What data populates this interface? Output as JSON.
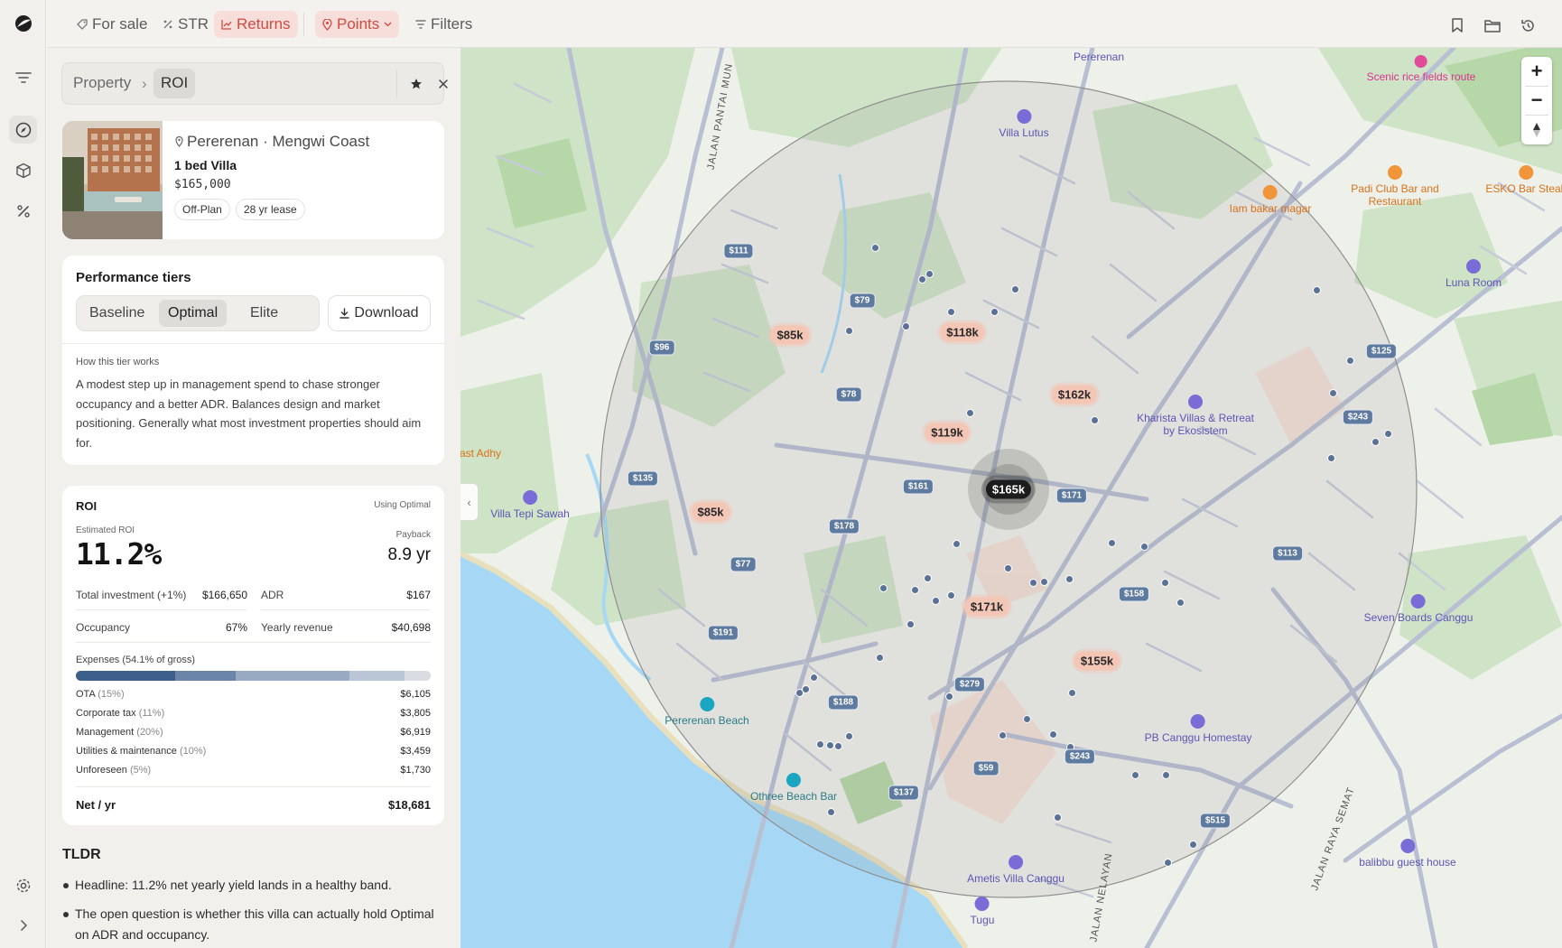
{
  "topbar": {
    "for_sale": "For sale",
    "str": "STR",
    "returns": "Returns",
    "points": "Points",
    "filters": "Filters"
  },
  "breadcrumb": {
    "parent": "Property",
    "current": "ROI"
  },
  "property": {
    "location": "Pererenan · Mengwi Coast",
    "title": "1 bed Villa",
    "price": "$165,000",
    "tags": [
      "Off-Plan",
      "28 yr lease"
    ]
  },
  "tiers": {
    "heading": "Performance tiers",
    "options": [
      "Baseline",
      "Optimal",
      "Elite"
    ],
    "selected": "Optimal",
    "download": "Download",
    "how_label": "How this tier works",
    "description": "A modest step up in management spend to chase stronger occupancy and a better ADR. Balances design and market positioning. Generally what most investment properties should aim for."
  },
  "roi": {
    "heading": "ROI",
    "using": "Using Optimal",
    "estimated_label": "Estimated ROI",
    "estimated_value": "11.2%",
    "payback_label": "Payback",
    "payback_value": "8.9 yr",
    "total_investment_label": "Total investment (+1%)",
    "total_investment_value": "$166,650",
    "adr_label": "ADR",
    "adr_value": "$167",
    "occupancy_label": "Occupancy",
    "occupancy_value": "67%",
    "yearly_revenue_label": "Yearly revenue",
    "yearly_revenue_value": "$40,698",
    "expenses_label": "Expenses (54.1% of gross)",
    "expenses": [
      {
        "label": "OTA",
        "pct": "(15%)",
        "value": "$6,105",
        "share": 0.28,
        "color": "#3e5f8a"
      },
      {
        "label": "Corporate tax",
        "pct": "(11%)",
        "value": "$3,805",
        "share": 0.17,
        "color": "#6b85a8"
      },
      {
        "label": "Management",
        "pct": "(20%)",
        "value": "$6,919",
        "share": 0.32,
        "color": "#98a9c2"
      },
      {
        "label": "Utilities & maintenance",
        "pct": "(10%)",
        "value": "$3,459",
        "share": 0.155,
        "color": "#bac5d5"
      },
      {
        "label": "Unforeseen",
        "pct": "(5%)",
        "value": "$1,730",
        "share": 0.075,
        "color": "#d9dde3"
      }
    ],
    "net_label": "Net / yr",
    "net_value": "$18,681"
  },
  "tldr": {
    "heading": "TLDR",
    "items": [
      "Headline: 11.2% net yearly yield lands in a healthy band.",
      "The open question is whether this villa can actually hold Optimal on ADR and occupancy."
    ]
  },
  "map": {
    "zoom_in": "+",
    "zoom_out": "−",
    "price_pins": [
      "$85k",
      "$118k",
      "$162k",
      "$119k",
      "$165k",
      "$85k",
      "$171k",
      "$155k"
    ],
    "listing_prices": [
      "$111",
      "$79",
      "$96",
      "$78",
      "$135",
      "$161",
      "$171",
      "$178",
      "$77",
      "$191",
      "$188",
      "$279",
      "$59",
      "$243",
      "$137",
      "$158",
      "$113",
      "$125",
      "$243",
      "$515"
    ],
    "pois": [
      "Pererenan",
      "Villa Lutus",
      "Scenic rice fields route",
      "Padi Club Bar and Restaurant",
      "ESKO Bar Steak",
      "Iam bakar magar",
      "Luna Room",
      "Kharista Villas & Retreat by Ekosistem",
      "Villa Tepi Sawah",
      "ast Adhy",
      "Seven Boards Canggu",
      "Pererenan Beach",
      "PB Canggu Homestay",
      "Othree Beach Bar",
      "Ametis Villa Canggu",
      "balibbu guest house",
      "Tugu"
    ],
    "roads": [
      "JALAN PANTAI MUN",
      "JALAN RAYA SEMAT",
      "JALAN NELAYAN"
    ]
  }
}
